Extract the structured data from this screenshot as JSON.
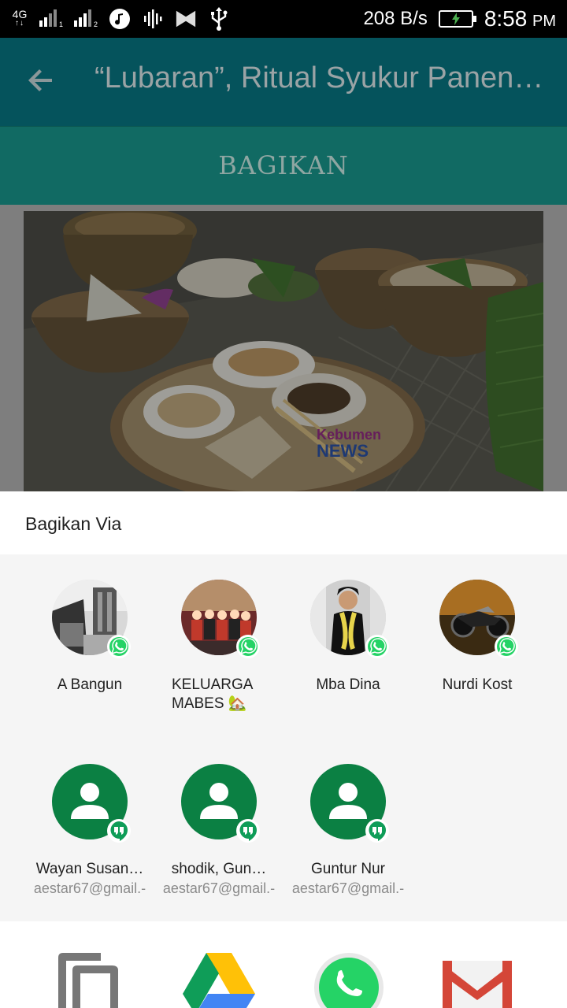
{
  "status_bar": {
    "network": "4G",
    "sim1_index": "1",
    "sim2_index": "2",
    "speed": "208 B/s",
    "time": "8:58",
    "ampm": "PM",
    "icons": [
      "signal-sim1-icon",
      "signal-sim2-icon",
      "music-icon",
      "audio-wave-icon",
      "bowtie-icon",
      "usb-icon",
      "battery-charging-icon"
    ]
  },
  "toolbar": {
    "back_icon": "arrow-back-icon",
    "title": "“Lubaran”, Ritual Syukur Panen…"
  },
  "share_bar": {
    "label": "BAGIKAN"
  },
  "article_image": {
    "watermark_line1": "Kebumen",
    "watermark_line2": "NEWS"
  },
  "share_sheet": {
    "title": "Bagikan Via",
    "direct_targets": [
      {
        "name": "A Bangun",
        "app_badge": "whatsapp-icon"
      },
      {
        "name": "KELUARGA MABES 🏡",
        "app_badge": "whatsapp-icon"
      },
      {
        "name": "Mba Dina",
        "app_badge": "whatsapp-icon"
      },
      {
        "name": "Nurdi Kost",
        "app_badge": "whatsapp-icon"
      },
      {
        "name": "Wayan Susan…",
        "sub": "aestar67@gmail.-",
        "app_badge": "hangouts-icon"
      },
      {
        "name": "shodik, Gun…",
        "sub": "aestar67@gmail.-",
        "app_badge": "hangouts-icon"
      },
      {
        "name": "Guntur Nur",
        "sub": "aestar67@gmail.-",
        "app_badge": "hangouts-icon"
      }
    ],
    "apps": [
      "copy-icon",
      "google-drive-icon",
      "whatsapp-icon",
      "gmail-icon"
    ]
  },
  "colors": {
    "toolbar": "#05535c",
    "share_bar": "#116a63",
    "contact_green": "#0b8043",
    "whatsapp_green": "#25d366"
  }
}
